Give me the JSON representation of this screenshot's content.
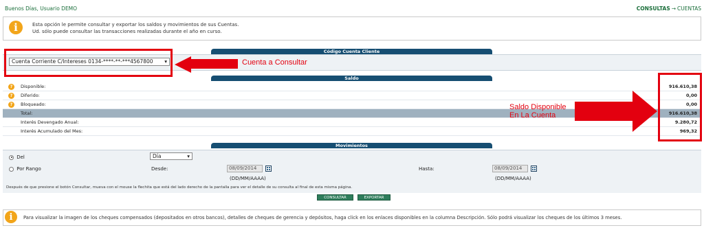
{
  "header": {
    "greeting": "Buenos Días, Usuario DEMO",
    "breadcrumb_section": "CONSULTAS",
    "breadcrumb_separator": "→",
    "breadcrumb_page": "CUENTAS"
  },
  "info": {
    "line1": "Esta opción le permite consultar y exportar los saldos y movimientos de sus Cuentas.",
    "line2": "Ud. sólo puede consultar las transacciones realizadas durante el año en curso."
  },
  "account": {
    "header": "Código Cuenta Cliente",
    "selected": "Cuenta Corriente C/Intereses 0134-****-**-***4567800",
    "annotation": "Cuenta a Consultar"
  },
  "saldo": {
    "header": "Saldo",
    "rows": [
      {
        "label": "Disponible:",
        "value": "916.610,38"
      },
      {
        "label": "Diferido:",
        "value": "0,00"
      },
      {
        "label": "Bloqueado:",
        "value": "0,00"
      },
      {
        "label": "Total:",
        "value": "916.610,38"
      },
      {
        "label": "Interés Devengado Anual:",
        "value": "9.280,72"
      },
      {
        "label": "Interés Acumulado del Mes:",
        "value": "969,32"
      }
    ],
    "annotation_line1": "Saldo Disponible",
    "annotation_line2": "En La Cuenta"
  },
  "movimientos": {
    "header": "Movimientos",
    "option_del": "Del",
    "del_select": "Día",
    "option_rango": "Por Rango",
    "desde_label": "Desde:",
    "desde_value": "08/09/2014",
    "hasta_label": "Hasta:",
    "hasta_value": "08/09/2014",
    "date_format": "(DD/MM/AAAA)",
    "note": "Después de que presione el botón Consultar, mueva con el mouse la flechita que está del lado derecho de la pantalla para ver el detalle de su consulta al final de esta misma página.",
    "consultar": "CONSULTAR",
    "exportar": "EXPORTAR"
  },
  "footer": {
    "text": "Para visualizar la imagen de los cheques compensados (depositados en otros bancos), detalles de cheques de gerencia y depósitos, haga click en los enlaces disponibles en la columna Descripción. Sólo podrá visualizar los cheques de los últimos 3 meses."
  },
  "colors": {
    "accent_green": "#1a6e3a",
    "header_blue": "#164e72",
    "annotation_red": "#e3000f",
    "info_orange": "#f2a51a"
  }
}
